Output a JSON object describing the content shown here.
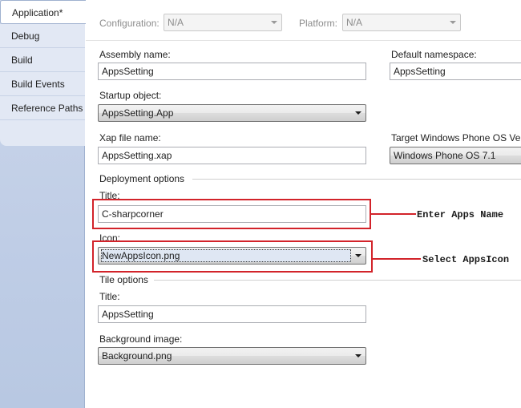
{
  "tabs": [
    {
      "label": "Application*",
      "active": true
    },
    {
      "label": "Debug",
      "active": false
    },
    {
      "label": "Build",
      "active": false
    },
    {
      "label": "Build Events",
      "active": false
    },
    {
      "label": "Reference Paths",
      "active": false
    }
  ],
  "toolbar": {
    "configuration_label": "Configuration:",
    "configuration_value": "N/A",
    "platform_label": "Platform:",
    "platform_value": "N/A"
  },
  "form": {
    "assembly_name_label": "Assembly name:",
    "assembly_name_value": "AppsSetting",
    "default_namespace_label": "Default namespace:",
    "default_namespace_value": "AppsSetting",
    "startup_object_label": "Startup object:",
    "startup_object_value": "AppsSetting.App",
    "xap_file_label": "Xap file name:",
    "xap_file_value": "AppsSetting.xap",
    "target_os_label": "Target Windows Phone OS Versio",
    "target_os_value": "Windows Phone OS 7.1",
    "deployment_options_label": "Deployment options",
    "deploy_title_label": "Title:",
    "deploy_title_value": "C-sharpcorner",
    "icon_label": "Icon:",
    "icon_value": "NewAppsIcon.png",
    "tile_options_label": "Tile options",
    "tile_title_label": "Title:",
    "tile_title_value": "AppsSetting",
    "background_image_label": "Background image:",
    "background_image_value": "Background.png"
  },
  "annotations": {
    "enter_apps_name": "Enter Apps Name",
    "select_apps_icon": "Select AppsIcon"
  },
  "colors": {
    "highlight_red": "#d2232a",
    "sidebar_blue": "#bfcde6"
  }
}
